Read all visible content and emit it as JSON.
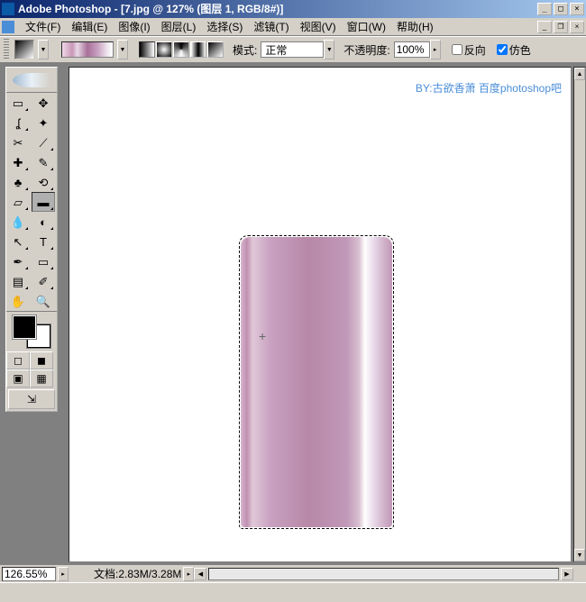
{
  "titlebar": {
    "title": "Adobe Photoshop - [7.jpg @ 127% (图层 1, RGB/8#)]"
  },
  "menu": {
    "file": "文件(F)",
    "edit": "编辑(E)",
    "image": "图像(I)",
    "layer": "图层(L)",
    "select": "选择(S)",
    "filter": "滤镜(T)",
    "view": "视图(V)",
    "window": "窗口(W)",
    "help": "帮助(H)"
  },
  "options": {
    "mode_label": "模式:",
    "mode_value": "正常",
    "opacity_label": "不透明度:",
    "opacity_value": "100%",
    "reverse_label": "反向",
    "dither_label": "仿色"
  },
  "canvas": {
    "credit": "BY:古欲香萧   百度photoshop吧"
  },
  "status": {
    "zoom": "126.55%",
    "doc_label": "文档:",
    "doc_size": "2.83M/3.28M"
  },
  "icons": {
    "min": "_",
    "max": "□",
    "close": "×",
    "restore": "❐",
    "down": "▼",
    "up": "▲",
    "left": "◀",
    "right": "▶",
    "arrow_play": "▸"
  },
  "colors": {
    "brand_credit": "#4a8ed8"
  }
}
